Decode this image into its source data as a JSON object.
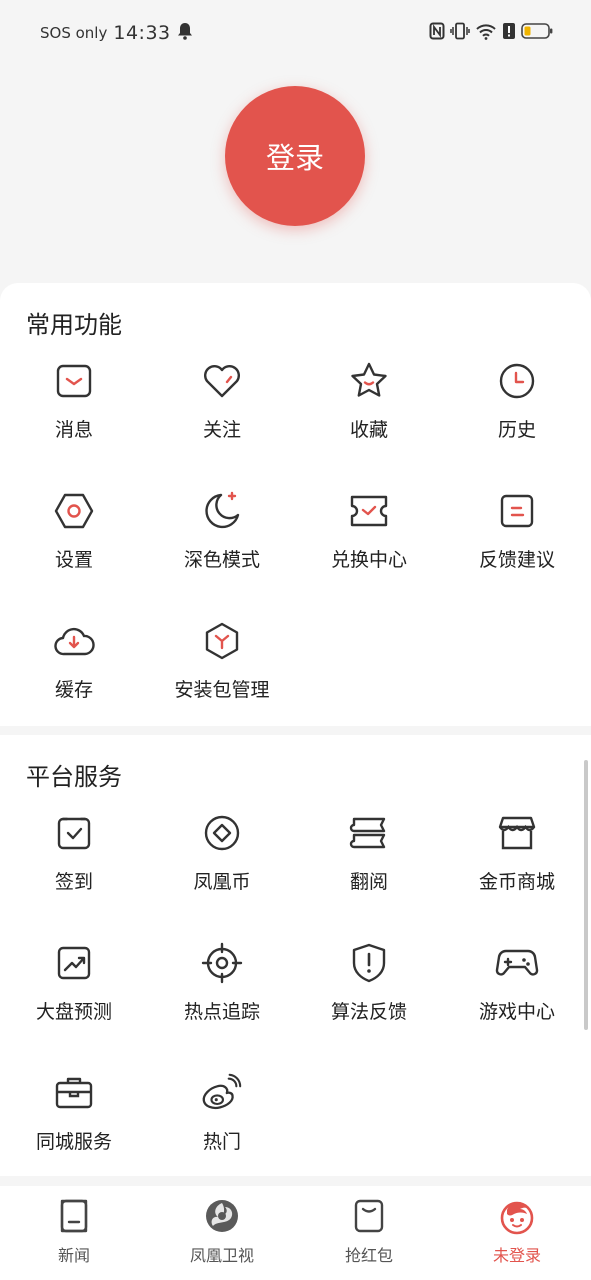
{
  "status_bar": {
    "sos": "SOS only",
    "time": "14:33",
    "icons": [
      "bell-icon",
      "nfc-icon",
      "vibrate-icon",
      "wifi-icon",
      "alert-icon",
      "battery-icon"
    ]
  },
  "login": {
    "label": "登录"
  },
  "sections": {
    "common": {
      "title": "常用功能",
      "items": [
        {
          "label": "消息",
          "icon": "message-icon"
        },
        {
          "label": "关注",
          "icon": "heart-icon"
        },
        {
          "label": "收藏",
          "icon": "star-icon"
        },
        {
          "label": "历史",
          "icon": "clock-icon"
        },
        {
          "label": "设置",
          "icon": "settings-icon"
        },
        {
          "label": "深色模式",
          "icon": "moon-icon"
        },
        {
          "label": "兑换中心",
          "icon": "ticket-icon"
        },
        {
          "label": "反馈建议",
          "icon": "feedback-icon"
        },
        {
          "label": "缓存",
          "icon": "cloud-download-icon"
        },
        {
          "label": "安装包管理",
          "icon": "package-icon"
        }
      ]
    },
    "platform": {
      "title": "平台服务",
      "items": [
        {
          "label": "签到",
          "icon": "checkin-icon"
        },
        {
          "label": "凤凰币",
          "icon": "coin-icon"
        },
        {
          "label": "翻阅",
          "icon": "book-icon"
        },
        {
          "label": "金币商城",
          "icon": "store-icon"
        },
        {
          "label": "大盘预测",
          "icon": "chart-icon"
        },
        {
          "label": "热点追踪",
          "icon": "target-icon"
        },
        {
          "label": "算法反馈",
          "icon": "shield-alert-icon"
        },
        {
          "label": "游戏中心",
          "icon": "gamepad-icon"
        },
        {
          "label": "同城服务",
          "icon": "briefcase-icon"
        },
        {
          "label": "热门",
          "icon": "weibo-icon"
        }
      ]
    }
  },
  "tabs": [
    {
      "label": "新闻",
      "icon": "news-icon"
    },
    {
      "label": "凤凰卫视",
      "icon": "phoenix-icon"
    },
    {
      "label": "抢红包",
      "icon": "red-packet-icon"
    },
    {
      "label": "未登录",
      "icon": "avatar-icon",
      "active": true
    }
  ],
  "colors": {
    "accent": "#e2544d",
    "icon_stroke": "#333333",
    "background": "#f5f5f5"
  }
}
